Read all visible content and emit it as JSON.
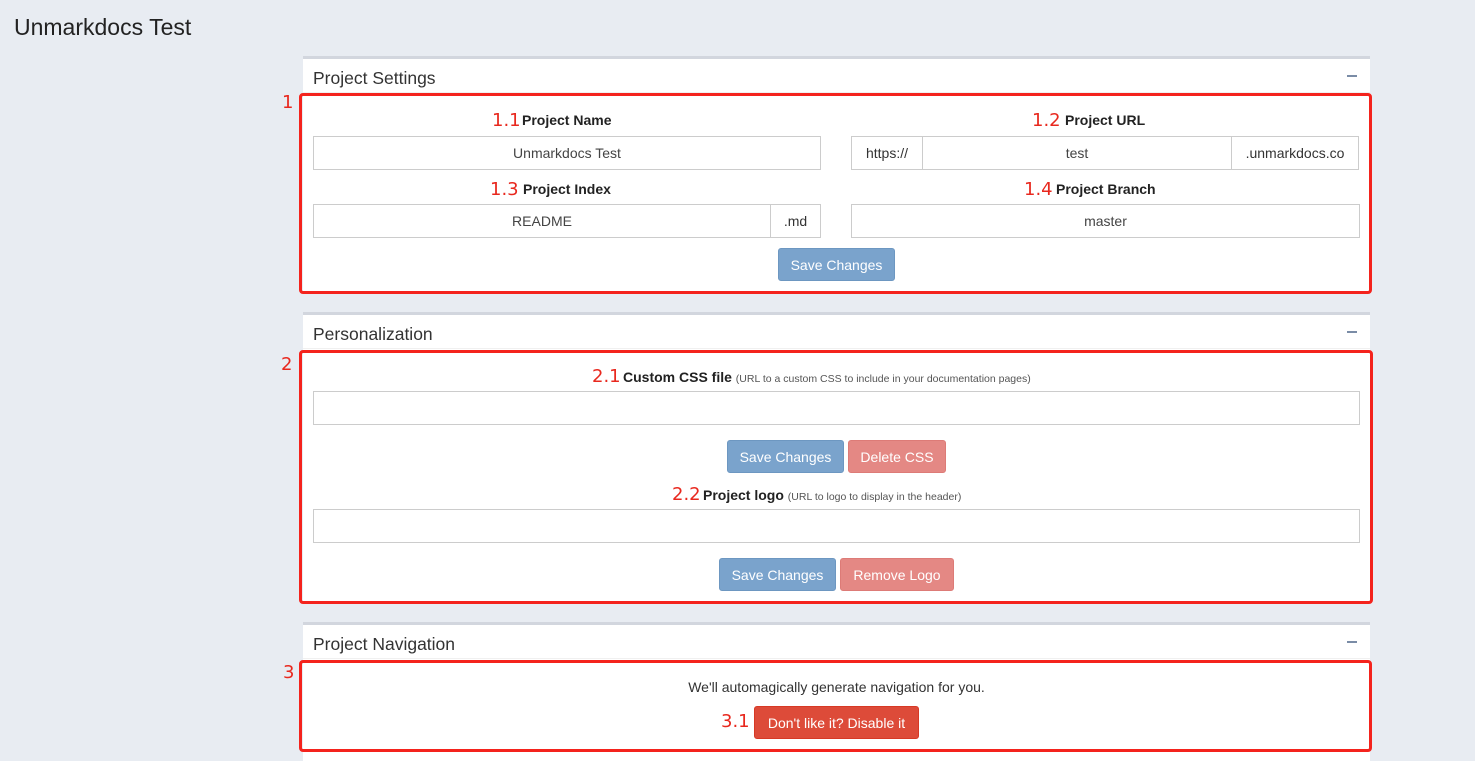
{
  "page": {
    "title": "Unmarkdocs Test"
  },
  "project_settings": {
    "title": "Project Settings",
    "annotation": "1",
    "project_name": {
      "annotation": "1.1",
      "label": "Project Name",
      "value": "Unmarkdocs Test"
    },
    "project_url": {
      "annotation": "1.2",
      "label": "Project URL",
      "prefix": "https://",
      "value": "test",
      "suffix": ".unmarkdocs.co"
    },
    "project_index": {
      "annotation": "1.3",
      "label": "Project Index",
      "value": "README",
      "suffix": ".md"
    },
    "project_branch": {
      "annotation": "1.4",
      "label": "Project Branch",
      "value": "master"
    },
    "save_label": "Save Changes"
  },
  "personalization": {
    "title": "Personalization",
    "annotation": "2",
    "custom_css": {
      "annotation": "2.1",
      "label": "Custom CSS file",
      "hint": "(URL to a custom CSS to include in your documentation pages)",
      "value": "",
      "save_label": "Save Changes",
      "delete_label": "Delete CSS"
    },
    "project_logo": {
      "annotation": "2.2",
      "label": "Project logo",
      "hint": "(URL to logo to display in the header)",
      "value": "",
      "save_label": "Save Changes",
      "remove_label": "Remove Logo"
    }
  },
  "project_navigation": {
    "title": "Project Navigation",
    "annotation": "3",
    "message": "We'll automagically generate navigation for you.",
    "disable": {
      "annotation": "3.1",
      "label": "Don't like it? Disable it"
    }
  },
  "colors": {
    "background": "#e8ecf2",
    "primary_button": "#7aa3cc",
    "danger_light_button": "#e48884",
    "danger_button": "#dd4b39",
    "annotation_red": "#f4231d"
  }
}
